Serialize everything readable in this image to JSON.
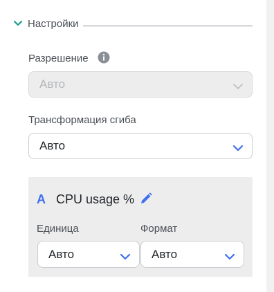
{
  "section": {
    "title": "Настройки"
  },
  "resolution": {
    "label": "Разрешение",
    "value": "Авто"
  },
  "fold_transform": {
    "label": "Трансформация сгиба",
    "value": "Авто"
  },
  "series": {
    "icon_letter": "A",
    "name": "CPU usage %",
    "unit": {
      "label": "Единица",
      "value": "Авто"
    },
    "format": {
      "label": "Формат",
      "value": "Авто"
    }
  },
  "colors": {
    "accent": "#3f6ff0",
    "teal": "#1a9a8c"
  }
}
